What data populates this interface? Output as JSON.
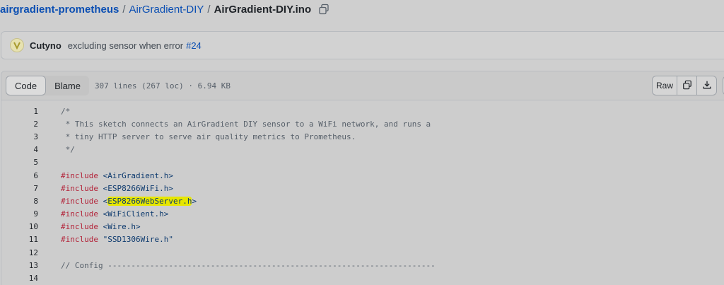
{
  "breadcrumb": {
    "repo": "airgradient-prometheus",
    "sep1": "/",
    "dir": "AirGradient-DIY",
    "sep2": "/",
    "file": "AirGradient-DIY.ino",
    "copy_icon": "copy-icon"
  },
  "commit": {
    "author": "Cutyno",
    "message": "excluding sensor when error",
    "pr": "#24",
    "avatar_icon": "user-avatar"
  },
  "file_header": {
    "tab_code": "Code",
    "tab_blame": "Blame",
    "meta": "307 lines (267 loc) · 6.94 KB",
    "raw_label": "Raw",
    "copy_icon": "copy-icon",
    "download_icon": "download-icon",
    "edit_icon": "pencil-icon"
  },
  "code": {
    "lines": [
      {
        "n": "1",
        "parts": [
          {
            "t": "/*",
            "c": "cm"
          }
        ]
      },
      {
        "n": "2",
        "parts": [
          {
            "t": " * This sketch connects an AirGradient DIY sensor to a WiFi network, and runs a",
            "c": "cm"
          }
        ]
      },
      {
        "n": "3",
        "parts": [
          {
            "t": " * tiny HTTP server to serve air quality metrics to Prometheus.",
            "c": "cm"
          }
        ]
      },
      {
        "n": "4",
        "parts": [
          {
            "t": " */",
            "c": "cm"
          }
        ]
      },
      {
        "n": "5",
        "parts": []
      },
      {
        "n": "6",
        "parts": [
          {
            "t": "#include",
            "c": "kw"
          },
          {
            "t": " <AirGradient.h>",
            "c": "str"
          }
        ]
      },
      {
        "n": "7",
        "parts": [
          {
            "t": "#include",
            "c": "kw"
          },
          {
            "t": " <ESP8266WiFi.h>",
            "c": "str"
          }
        ]
      },
      {
        "n": "8",
        "parts": [
          {
            "t": "#include",
            "c": "kw"
          },
          {
            "t": " <",
            "c": "str"
          },
          {
            "t": "ESP8266WebServer.h",
            "c": "str hl"
          },
          {
            "t": ">",
            "c": "str"
          }
        ]
      },
      {
        "n": "9",
        "parts": [
          {
            "t": "#include",
            "c": "kw"
          },
          {
            "t": " <WiFiClient.h>",
            "c": "str"
          }
        ]
      },
      {
        "n": "10",
        "parts": [
          {
            "t": "#include",
            "c": "kw"
          },
          {
            "t": " <Wire.h>",
            "c": "str"
          }
        ]
      },
      {
        "n": "11",
        "parts": [
          {
            "t": "#include",
            "c": "kw"
          },
          {
            "t": " \"SSD1306Wire.h\"",
            "c": "str"
          }
        ]
      },
      {
        "n": "12",
        "parts": []
      },
      {
        "n": "13",
        "parts": [
          {
            "t": "// Config ----------------------------------------------------------------------",
            "c": "cm"
          }
        ]
      },
      {
        "n": "14",
        "parts": []
      }
    ]
  }
}
